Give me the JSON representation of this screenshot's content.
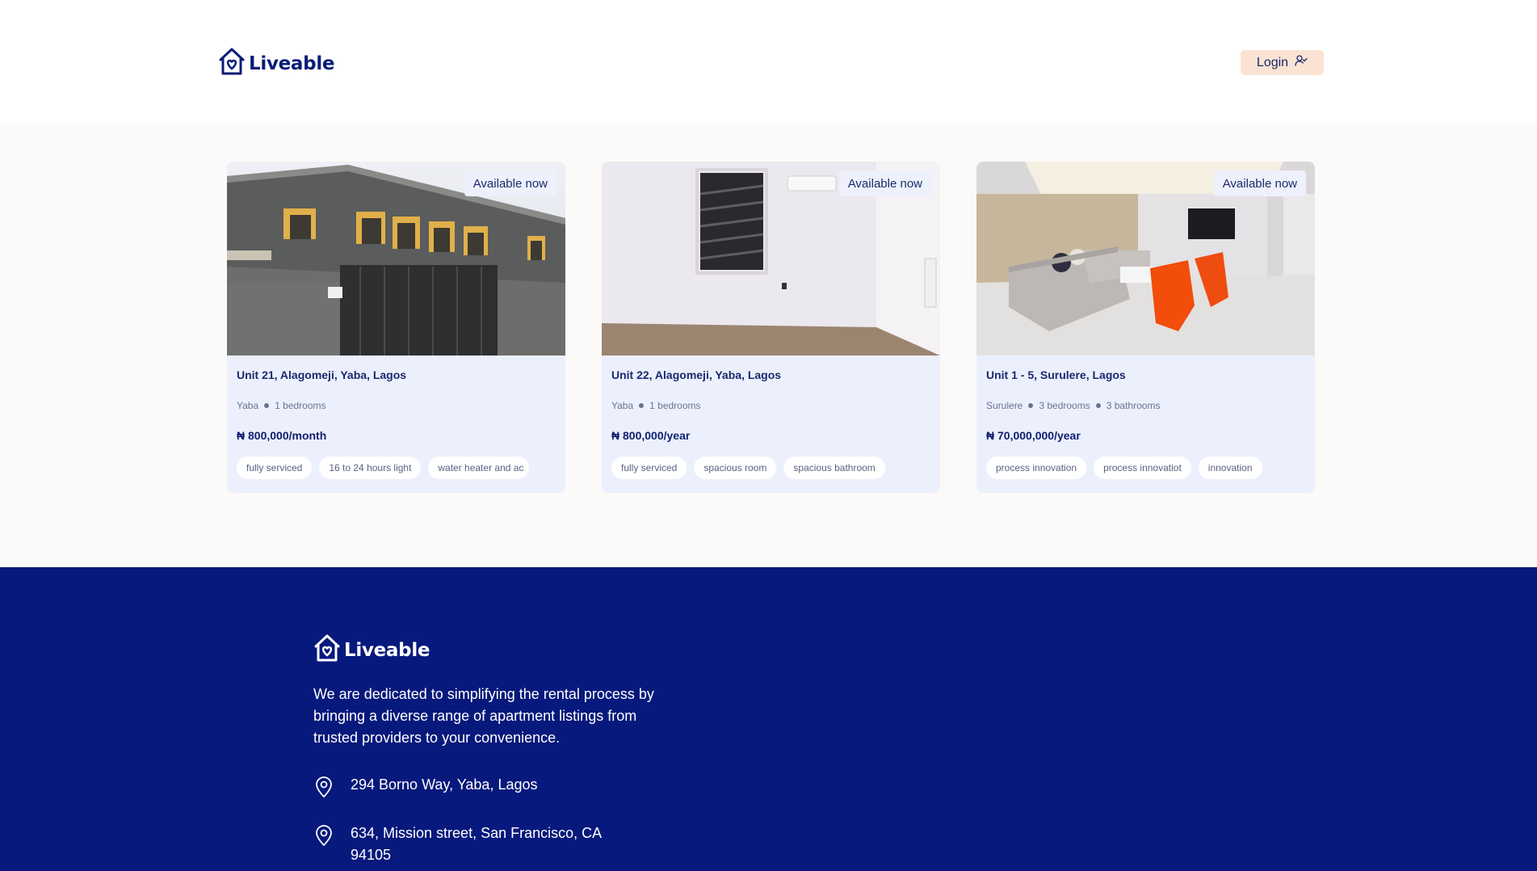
{
  "header": {
    "brand": "Liveable",
    "login_label": "Login"
  },
  "listings": [
    {
      "badge": "Available now",
      "title": "Unit 21, Alagomeji, Yaba, Lagos",
      "meta": [
        "Yaba",
        "1 bedrooms"
      ],
      "price": "₦ 800,000/month",
      "tags": [
        "fully serviced",
        "16 to 24 hours light",
        "water heater and ac"
      ]
    },
    {
      "badge": "Available now",
      "title": "Unit 22, Alagomeji, Yaba, Lagos",
      "meta": [
        "Yaba",
        "1 bedrooms"
      ],
      "price": "₦ 800,000/year",
      "tags": [
        "fully serviced",
        "spacious room",
        "spacious bathroom"
      ]
    },
    {
      "badge": "Available now",
      "title": "Unit 1 - 5, Surulere, Lagos",
      "meta": [
        "Surulere",
        "3 bedrooms",
        "3 bathrooms"
      ],
      "price": "₦ 70,000,000/year",
      "tags": [
        "process innovation",
        "process innovatiot",
        "innovation"
      ]
    }
  ],
  "footer": {
    "brand": "Liveable",
    "description": "We are dedicated to simplifying the rental process by bringing a diverse range of apartment listings from trusted providers to your convenience.",
    "addresses": [
      "294 Borno Way, Yaba, Lagos",
      "634, Mission street, San Francisco, CA 94105"
    ]
  },
  "colors": {
    "brand_navy": "#0a1c78",
    "footer_bg": "#07197c",
    "login_bg": "#fbe3d3",
    "card_bg": "#ecf0fd"
  },
  "icons": [
    "house-heart-icon",
    "user-check-icon",
    "location-pin-icon"
  ]
}
